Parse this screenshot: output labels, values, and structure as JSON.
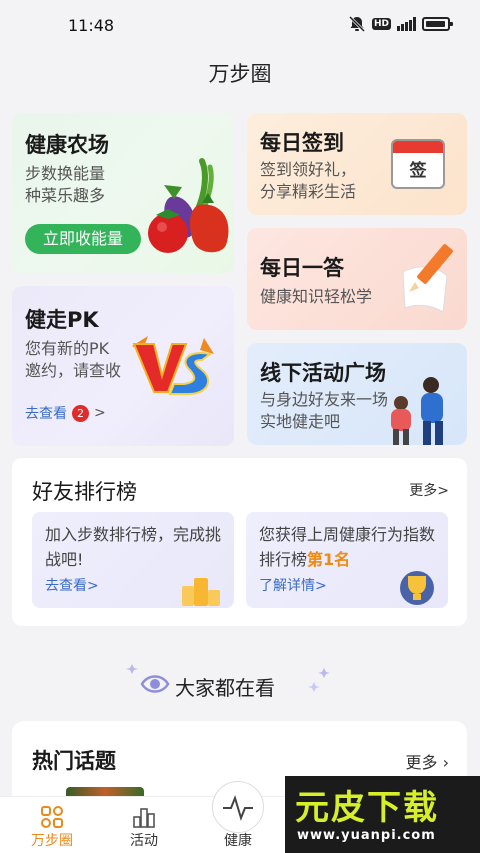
{
  "status_bar": {
    "time": "11:48"
  },
  "header": {
    "title": "万步圈"
  },
  "cards": {
    "farm": {
      "title": "健康农场",
      "subtitle": "步数换能量\n种菜乐趣多",
      "button": "立即收能量"
    },
    "pk": {
      "title": "健走PK",
      "subtitle": "您有新的PK\n邀约，请查收",
      "link": "去查看",
      "badge": "2",
      "arrow": ">"
    },
    "signin": {
      "title": "每日签到",
      "subtitle": "签到领好礼，\n分享精彩生活",
      "calendar_label": "签"
    },
    "answer": {
      "title": "每日一答",
      "subtitle": "健康知识轻松学"
    },
    "offline": {
      "title": "线下活动广场",
      "subtitle": "与身边好友来一场\n实地健走吧"
    }
  },
  "rank": {
    "title": "好友排行榜",
    "more": "更多>",
    "left": {
      "text": "加入步数排行榜，完成挑战吧!",
      "link": "去查看>"
    },
    "right": {
      "text_before": "您获得上周健康行为指数排行榜",
      "highlight": "第1名",
      "link": "了解详情>"
    }
  },
  "everyone": {
    "title": "大家都在看"
  },
  "topics": {
    "title": "热门话题",
    "more": "更多"
  },
  "tabs": [
    {
      "label": "万步圈",
      "icon": "grid-icon",
      "active": true
    },
    {
      "label": "活动",
      "icon": "chart-icon",
      "active": false
    },
    {
      "label": "健康",
      "icon": "pulse-icon",
      "active": false
    }
  ],
  "watermark": {
    "big": "元皮下载",
    "small": "www.yuanpi.com"
  },
  "colors": {
    "accent": "#e98a1c",
    "green": "#33b35a",
    "link": "#3a6bc8",
    "highlight": "#f08a12"
  }
}
